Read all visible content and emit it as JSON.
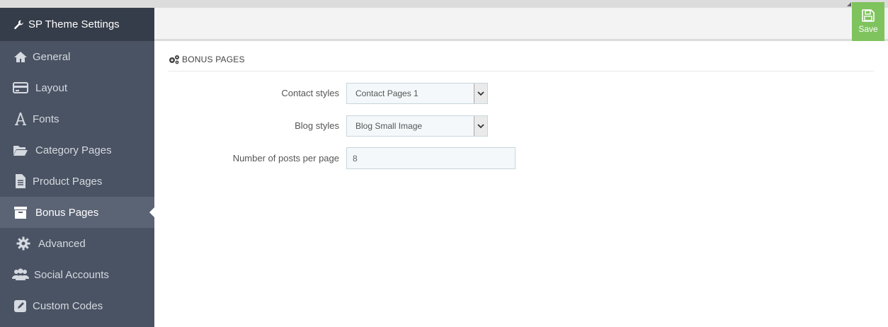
{
  "sidebar": {
    "title": "SP Theme Settings",
    "title_icon": "wrench-icon",
    "items": [
      {
        "label": "General",
        "icon": "home-icon"
      },
      {
        "label": "Layout",
        "icon": "credit-card-icon"
      },
      {
        "label": "Fonts",
        "icon": "font-icon"
      },
      {
        "label": "Category Pages",
        "icon": "folder-open-icon"
      },
      {
        "label": "Product Pages",
        "icon": "file-text-icon"
      },
      {
        "label": "Bonus Pages",
        "icon": "archive-icon",
        "active": true
      },
      {
        "label": "Advanced",
        "icon": "gear-icon"
      },
      {
        "label": "Social Accounts",
        "icon": "users-icon"
      },
      {
        "label": "Custom Codes",
        "icon": "edit-icon"
      }
    ]
  },
  "toolbar": {
    "save_label": "Save",
    "save_color": "#7fc35e"
  },
  "panel": {
    "heading": "BONUS PAGES",
    "heading_icon": "gears-icon"
  },
  "form": {
    "contact_styles": {
      "label": "Contact styles",
      "value": "Contact Pages 1"
    },
    "blog_styles": {
      "label": "Blog styles",
      "value": "Blog Small Image"
    },
    "posts_per_page": {
      "label": "Number of posts per page",
      "value": "8"
    }
  },
  "colors": {
    "sidebar_bg": "#4a5363",
    "sidebar_title_bg": "#363d4a",
    "sidebar_active_bg": "#5b6475"
  }
}
